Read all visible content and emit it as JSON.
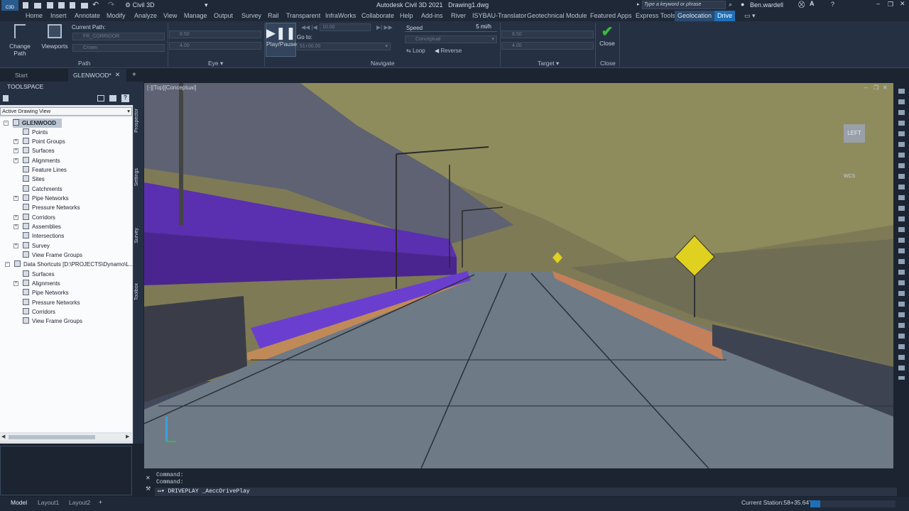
{
  "title": {
    "app_badge": "C3D",
    "workspace": "Civil 3D",
    "app_title": "Autodesk Civil 3D 2021",
    "drawing": "Drawing1.dwg",
    "search_placeholder": "Type a keyword or phrase",
    "user": "Ben.wardell"
  },
  "menu": [
    "Home",
    "Insert",
    "Annotate",
    "Modify",
    "Analyze",
    "View",
    "Manage",
    "Output",
    "Survey",
    "Rail",
    "Transparent",
    "InfraWorks",
    "Collaborate",
    "Help",
    "Add-ins",
    "River",
    "ISYBAU-Translator",
    "Geotechnical Module",
    "Featured Apps",
    "Express Tools",
    "Geolocation",
    "Drive"
  ],
  "ribbon": {
    "change_path": "Change Path",
    "viewports": "Viewports",
    "current_path_label": "Current Path:",
    "path_value": "FR_CORRIDOR",
    "path_sub": "Crown",
    "path_panel": "Path",
    "eye_h1": "8.50",
    "eye_h2": "4.00",
    "eye_panel": "Eye",
    "play_pause": "Play/Pause",
    "nav_value": "10.00",
    "goto_label": "Go to:",
    "goto_value": "51+00.00",
    "navigate_panel": "Navigate",
    "speed_label": "Speed",
    "speed_value": "5 mi/h",
    "visual_style": "Conceptual",
    "loop": "Loop",
    "reverse": "Reverse",
    "target_h1": "8.50",
    "target_h2": "4.00",
    "target_panel": "Target",
    "close_btn": "Close",
    "close_panel": "Close"
  },
  "tabs": {
    "start": "Start",
    "drawing": "GLENWOOD*"
  },
  "toolspace": {
    "title": "TOOLSPACE",
    "view": "Active Drawing View",
    "root": "GLENWOOD",
    "items": [
      "Points",
      "Point Groups",
      "Surfaces",
      "Alignments",
      "Feature Lines",
      "Sites",
      "Catchments",
      "Pipe Networks",
      "Pressure Networks",
      "Corridors",
      "Assemblies",
      "Intersections",
      "Survey",
      "View Frame Groups"
    ],
    "shortcuts": "Data Shortcuts [D:\\PROJECTS\\Dynamo\\L...",
    "shortcut_items": [
      "Surfaces",
      "Alignments",
      "Pipe Networks",
      "Pressure Networks",
      "Corridors",
      "View Frame Groups"
    ],
    "side_tabs": [
      "Prospector",
      "Settings",
      "Survey",
      "Toolbox"
    ]
  },
  "viewport": {
    "label": "[-][Top][Conceptual]",
    "viewcube": "LEFT",
    "wcs": "WCS"
  },
  "command": {
    "line1": "Command:",
    "line2": "Command:",
    "input": "DRIVEPLAY _AeccDrivePlay"
  },
  "status": {
    "model": "Model",
    "layout1": "Layout1",
    "layout2": "Layout2",
    "station": "Current Station:58+35.64'"
  },
  "colors": {
    "accent": "#1f6fb8",
    "check": "#3cba3c",
    "barrier": "#6a3fd0",
    "sign": "#e0d020"
  }
}
